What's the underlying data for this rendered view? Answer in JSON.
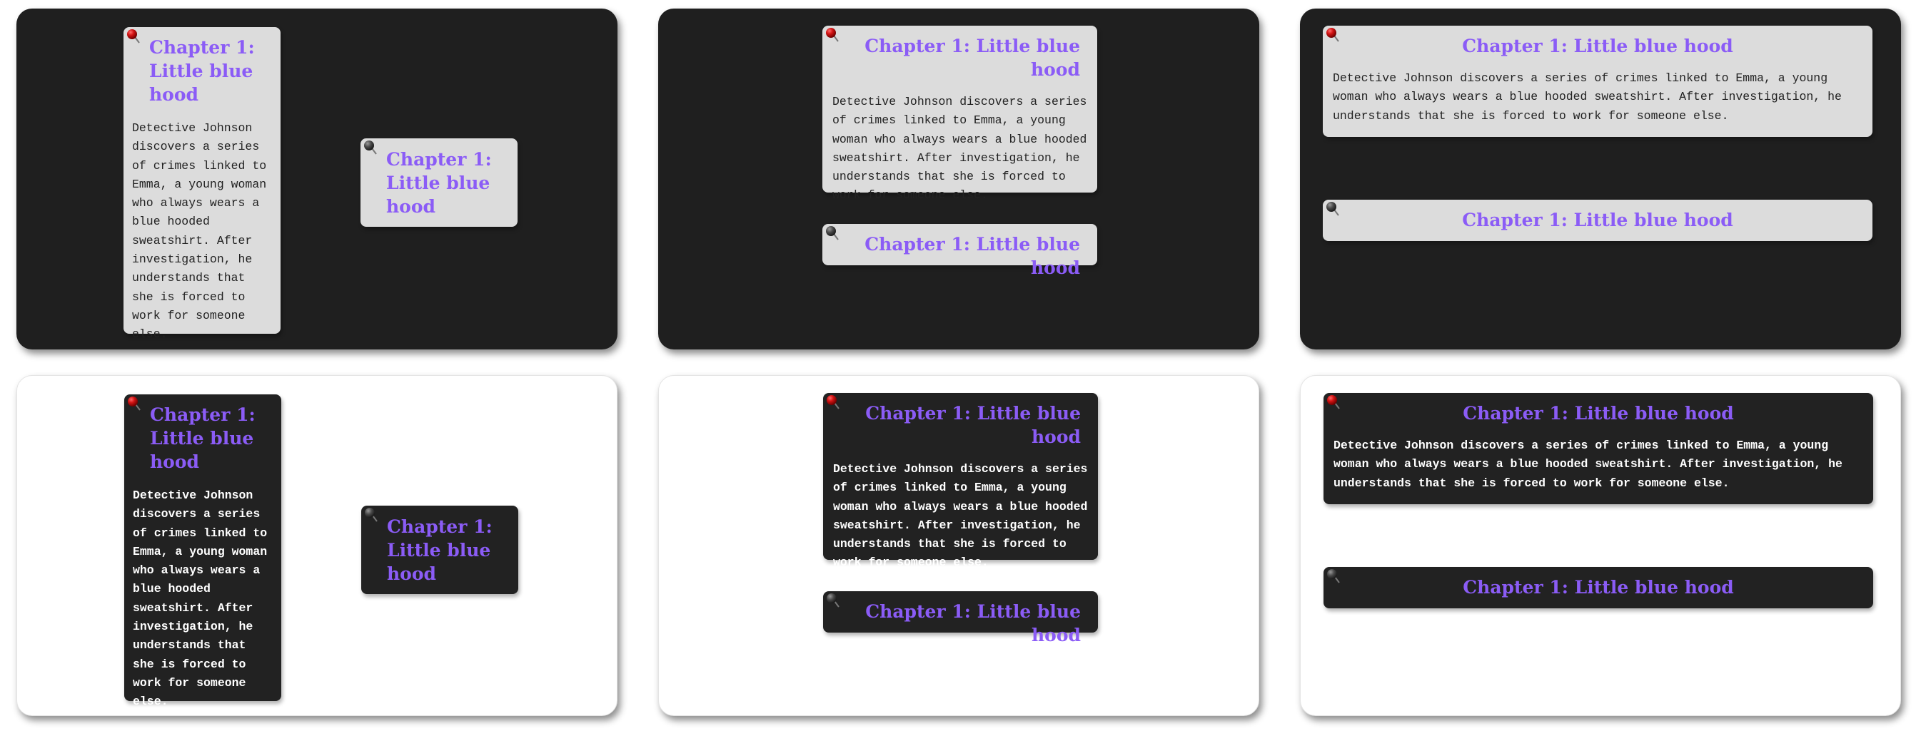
{
  "card": {
    "title": "Chapter 1: Little blue hood",
    "description": "Detective Johnson discovers a series of crimes linked to Emma, a young woman who always wears a blue hooded sweatshirt. After investigation, he understands that she is forced to work for someone else."
  },
  "colors": {
    "title_accent": "#8b5cf6",
    "dark_panel": "#1f1f1f",
    "light_card": "#dcdcdc",
    "dark_card": "#222222",
    "pin_red": "#cc1111",
    "pin_gray": "#555555"
  },
  "icons": {
    "active_pin": "red-pushpin-icon",
    "inactive_pin": "gray-pushpin-icon"
  }
}
